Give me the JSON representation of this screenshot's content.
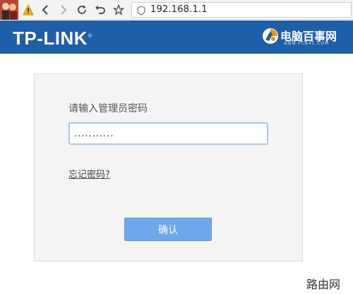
{
  "browser": {
    "url": "192.168.1.1",
    "icons": [
      "tab-favicon",
      "warning-icon",
      "back-icon",
      "forward-icon",
      "reload-icon",
      "undo-icon",
      "bookmark-star-icon",
      "shield-icon"
    ]
  },
  "header": {
    "brand": "TP-LINK",
    "brand_mark": "®",
    "background_color": "#1f5ea8",
    "watermark_name": "电脑百事网",
    "watermark_url": "www.PC841.COM"
  },
  "login": {
    "prompt_label": "请输入管理员密码",
    "password_value": "...........",
    "forgot_link": "忘记密码?",
    "confirm_button": "确认",
    "button_color": "#6ea7ec"
  },
  "footer": {
    "site_watermark": "路由网"
  }
}
